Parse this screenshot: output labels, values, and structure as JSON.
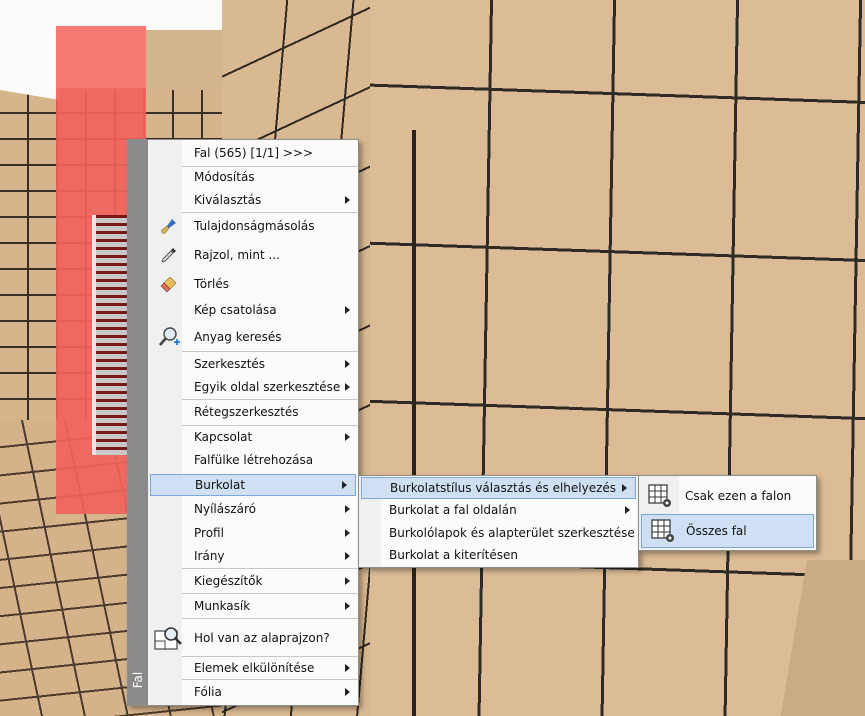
{
  "main_menu": {
    "sidebar_label": "Fal",
    "items": [
      {
        "label": "Fal (565) [1/1] >>>",
        "icon": "",
        "submenu": false
      },
      {
        "label": "Módosítás",
        "icon": "",
        "submenu": false
      },
      {
        "label": "Kiválasztás",
        "icon": "",
        "submenu": true
      },
      {
        "label": "Tulajdonságmásolás",
        "icon": "brush-icon",
        "submenu": false
      },
      {
        "label": "Rajzol, mint ...",
        "icon": "pipette-icon",
        "submenu": false
      },
      {
        "label": "Törlés",
        "icon": "eraser-icon",
        "submenu": false
      },
      {
        "label": "Kép csatolása",
        "icon": "",
        "submenu": true
      },
      {
        "label": "Anyag keresés",
        "icon": "magnifier-plus-icon",
        "submenu": false
      },
      {
        "label": "Szerkesztés",
        "icon": "",
        "submenu": true
      },
      {
        "label": "Egyik oldal szerkesztése",
        "icon": "",
        "submenu": true
      },
      {
        "label": "Rétegszerkesztés",
        "icon": "",
        "submenu": false
      },
      {
        "label": "Kapcsolat",
        "icon": "",
        "submenu": true
      },
      {
        "label": "Falfülke létrehozása",
        "icon": "",
        "submenu": false
      },
      {
        "label": "Burkolat",
        "icon": "",
        "submenu": true,
        "highlighted": true
      },
      {
        "label": "Nyílászáró",
        "icon": "",
        "submenu": true
      },
      {
        "label": "Profil",
        "icon": "",
        "submenu": true
      },
      {
        "label": "Irány",
        "icon": "",
        "submenu": true
      },
      {
        "label": "Kiegészítők",
        "icon": "",
        "submenu": true
      },
      {
        "label": "Munkasík",
        "icon": "",
        "submenu": true
      },
      {
        "label": "Hol van az alaprajzon?",
        "icon": "floorplan-search-icon",
        "submenu": false
      },
      {
        "label": "Elemek elkülönítése",
        "icon": "",
        "submenu": true
      },
      {
        "label": "Fólia",
        "icon": "",
        "submenu": true
      }
    ]
  },
  "sub_menu": {
    "items": [
      {
        "label": "Burkolatstílus választás és elhelyezés",
        "submenu": true,
        "highlighted": true
      },
      {
        "label": "Burkolat a fal oldalán",
        "submenu": true
      },
      {
        "label": "Burkolólapok és alapterület szerkesztése",
        "submenu": false
      },
      {
        "label": "Burkolat a kiterítésen",
        "submenu": false
      }
    ]
  },
  "sub2_menu": {
    "items": [
      {
        "label": "Csak ezen a falon",
        "icon": "tile-grid-gear-icon"
      },
      {
        "label": "Összes fal",
        "icon": "tile-grid-gear-icon",
        "highlighted": true
      }
    ]
  },
  "colors": {
    "highlight": "#cfe0f5",
    "highlight_border": "#7aa7dc",
    "sidebar": "#8a8a8a"
  }
}
